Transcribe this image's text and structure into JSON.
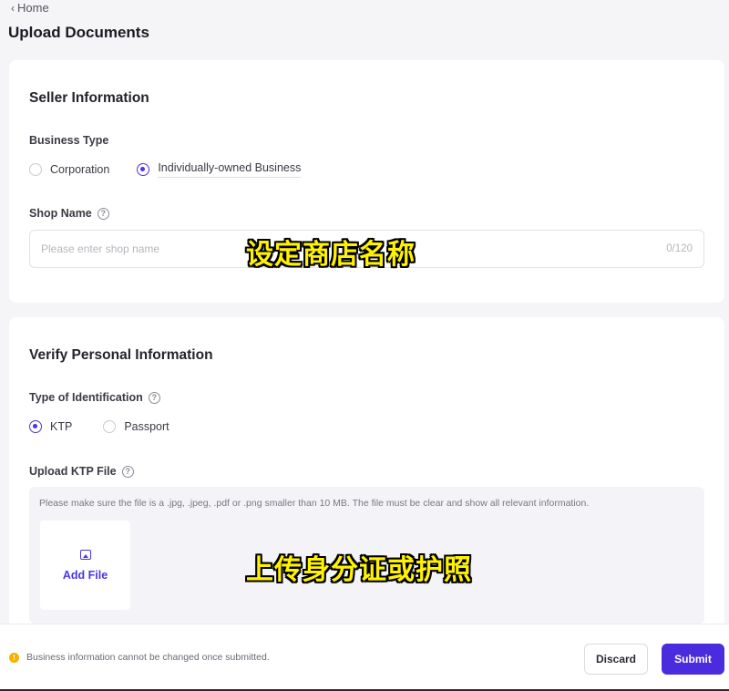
{
  "nav": {
    "back_label": "Home",
    "back_icon": "chevron-left-icon"
  },
  "page": {
    "title": "Upload Documents"
  },
  "seller": {
    "title": "Seller Information",
    "business_type_label": "Business Type",
    "business_type_options": [
      {
        "label": "Corporation",
        "selected": false
      },
      {
        "label": "Individually-owned Business",
        "selected": true
      }
    ],
    "shop_name_label": "Shop Name",
    "shop_name_placeholder": "Please enter shop name",
    "shop_name_value": "",
    "shop_name_counter": "0/120"
  },
  "verify": {
    "title": "Verify Personal Information",
    "id_type_label": "Type of Identification",
    "id_type_options": [
      {
        "label": "KTP",
        "selected": true
      },
      {
        "label": "Passport",
        "selected": false
      }
    ],
    "upload_label": "Upload KTP File",
    "upload_hint": "Please make sure the file is a .jpg, .jpeg, .pdf or .png smaller than 10 MB. The file must be clear and show all relevant information.",
    "add_file_label": "Add File"
  },
  "captions": {
    "shop_name_caption": "设定商店名称",
    "upload_caption": "上传身分证或护照"
  },
  "footer": {
    "note": "Business information cannot be changed once submitted.",
    "discard_label": "Discard",
    "submit_label": "Submit"
  },
  "colors": {
    "accent": "#4a35e6",
    "submit_bg": "#4a2cde",
    "warning": "#f5b100",
    "caption_text": "#fff200"
  }
}
